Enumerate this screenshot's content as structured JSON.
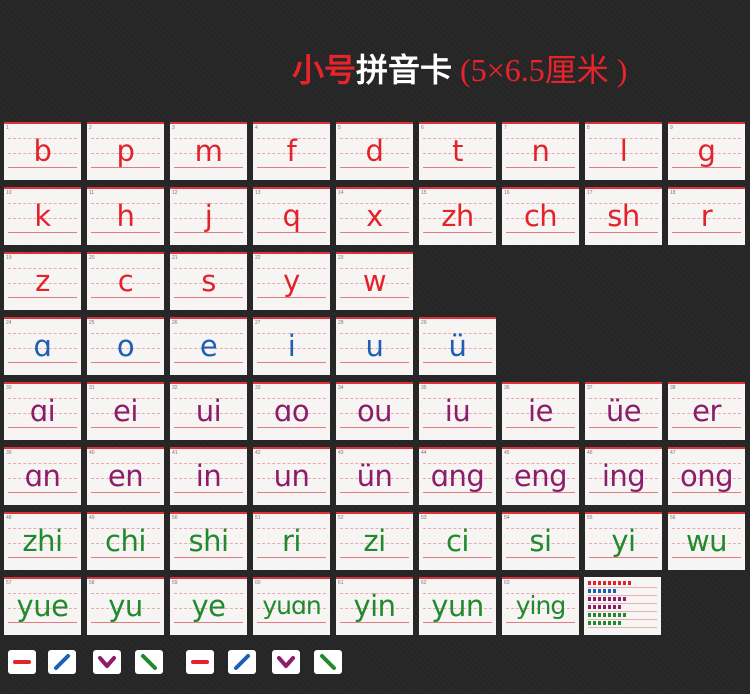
{
  "title": {
    "part1": "小号",
    "part2": "拼音卡",
    "part3": " (5×6.5厘米 )"
  },
  "cards": [
    {
      "n": "1",
      "t": "b",
      "c": "red"
    },
    {
      "n": "2",
      "t": "p",
      "c": "red"
    },
    {
      "n": "3",
      "t": "m",
      "c": "red"
    },
    {
      "n": "4",
      "t": "f",
      "c": "red"
    },
    {
      "n": "5",
      "t": "d",
      "c": "red"
    },
    {
      "n": "6",
      "t": "t",
      "c": "red"
    },
    {
      "n": "7",
      "t": "n",
      "c": "red"
    },
    {
      "n": "8",
      "t": "l",
      "c": "red"
    },
    {
      "n": "9",
      "t": "g",
      "c": "red"
    },
    {
      "n": "10",
      "t": "k",
      "c": "red"
    },
    {
      "n": "11",
      "t": "h",
      "c": "red"
    },
    {
      "n": "12",
      "t": "j",
      "c": "red"
    },
    {
      "n": "13",
      "t": "q",
      "c": "red"
    },
    {
      "n": "14",
      "t": "x",
      "c": "red"
    },
    {
      "n": "15",
      "t": "zh",
      "c": "red"
    },
    {
      "n": "16",
      "t": "ch",
      "c": "red"
    },
    {
      "n": "17",
      "t": "sh",
      "c": "red"
    },
    {
      "n": "18",
      "t": "r",
      "c": "red"
    },
    {
      "n": "19",
      "t": "z",
      "c": "red"
    },
    {
      "n": "20",
      "t": "c",
      "c": "red"
    },
    {
      "n": "21",
      "t": "s",
      "c": "red"
    },
    {
      "n": "22",
      "t": "y",
      "c": "red"
    },
    {
      "n": "23",
      "t": "w",
      "c": "red"
    },
    {
      "n": "24",
      "t": "ɑ",
      "c": "blue"
    },
    {
      "n": "25",
      "t": "o",
      "c": "blue"
    },
    {
      "n": "26",
      "t": "e",
      "c": "blue"
    },
    {
      "n": "27",
      "t": "i",
      "c": "blue"
    },
    {
      "n": "28",
      "t": "u",
      "c": "blue"
    },
    {
      "n": "29",
      "t": "ü",
      "c": "blue"
    },
    {
      "n": "30",
      "t": "ɑi",
      "c": "purple"
    },
    {
      "n": "31",
      "t": "ei",
      "c": "purple"
    },
    {
      "n": "32",
      "t": "ui",
      "c": "purple"
    },
    {
      "n": "33",
      "t": "ɑo",
      "c": "purple"
    },
    {
      "n": "34",
      "t": "ou",
      "c": "purple"
    },
    {
      "n": "35",
      "t": "iu",
      "c": "purple"
    },
    {
      "n": "36",
      "t": "ie",
      "c": "purple"
    },
    {
      "n": "37",
      "t": "üe",
      "c": "purple"
    },
    {
      "n": "38",
      "t": "er",
      "c": "purple"
    },
    {
      "n": "39",
      "t": "ɑn",
      "c": "purple"
    },
    {
      "n": "40",
      "t": "en",
      "c": "purple"
    },
    {
      "n": "41",
      "t": "in",
      "c": "purple"
    },
    {
      "n": "42",
      "t": "un",
      "c": "purple"
    },
    {
      "n": "43",
      "t": "ün",
      "c": "purple"
    },
    {
      "n": "44",
      "t": "ɑng",
      "c": "purple"
    },
    {
      "n": "45",
      "t": "eng",
      "c": "purple"
    },
    {
      "n": "46",
      "t": "ing",
      "c": "purple"
    },
    {
      "n": "47",
      "t": "ong",
      "c": "purple"
    },
    {
      "n": "48",
      "t": "zhi",
      "c": "green"
    },
    {
      "n": "49",
      "t": "chi",
      "c": "green"
    },
    {
      "n": "50",
      "t": "shi",
      "c": "green"
    },
    {
      "n": "51",
      "t": "ri",
      "c": "green"
    },
    {
      "n": "52",
      "t": "zi",
      "c": "green"
    },
    {
      "n": "53",
      "t": "ci",
      "c": "green"
    },
    {
      "n": "54",
      "t": "si",
      "c": "green"
    },
    {
      "n": "55",
      "t": "yi",
      "c": "green"
    },
    {
      "n": "56",
      "t": "wu",
      "c": "green"
    },
    {
      "n": "57",
      "t": "yue",
      "c": "green"
    },
    {
      "n": "58",
      "t": "yu",
      "c": "green"
    },
    {
      "n": "59",
      "t": "ye",
      "c": "green"
    },
    {
      "n": "60",
      "t": "yuɑn",
      "c": "green"
    },
    {
      "n": "61",
      "t": "yin",
      "c": "green"
    },
    {
      "n": "62",
      "t": "yun",
      "c": "green"
    },
    {
      "n": "63",
      "t": "ying",
      "c": "green"
    }
  ],
  "colors": {
    "red": "#e3232a",
    "blue": "#1d5fb3",
    "purple": "#8b1d69",
    "green": "#208a2c",
    "background": "#262626"
  },
  "tools": [
    {
      "icon": "minus-icon",
      "color": "#e3232a"
    },
    {
      "icon": "slash-icon",
      "color": "#1d5fb3"
    },
    {
      "icon": "check-icon",
      "color": "#8b1d69"
    },
    {
      "icon": "backslash-icon",
      "color": "#208a2c"
    },
    {
      "icon": "minus-icon",
      "color": "#e3232a"
    },
    {
      "icon": "slash-icon",
      "color": "#1d5fb3"
    },
    {
      "icon": "check-icon",
      "color": "#8b1d69"
    },
    {
      "icon": "backslash-icon",
      "color": "#208a2c"
    }
  ]
}
